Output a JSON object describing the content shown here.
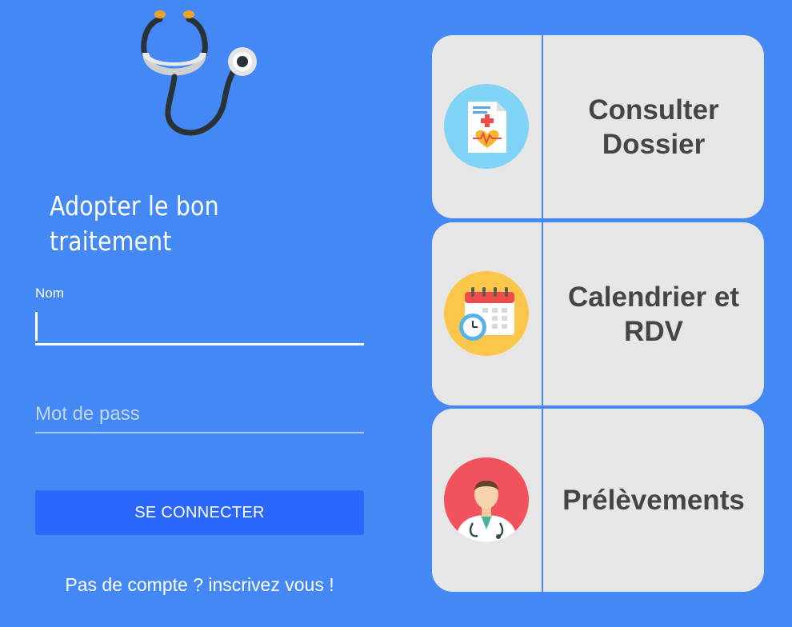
{
  "app": {
    "tagline": "Adopter le bon traitement"
  },
  "login": {
    "name_label": "Nom",
    "name_value": "",
    "password_placeholder": "Mot de pass",
    "submit_label": "SE CONNECTER",
    "signup_link": "Pas de compte ? inscrivez vous !"
  },
  "menu": [
    {
      "label": "Consulter Dossier",
      "icon": "medical-record-icon"
    },
    {
      "label": "Calendrier et RDV",
      "icon": "calendar-clock-icon"
    },
    {
      "label": "Prélèvements",
      "icon": "doctor-icon"
    }
  ],
  "colors": {
    "background": "#4388f5",
    "button": "#2b66fd",
    "card": "#e6e6e6",
    "card_text": "#454545"
  }
}
